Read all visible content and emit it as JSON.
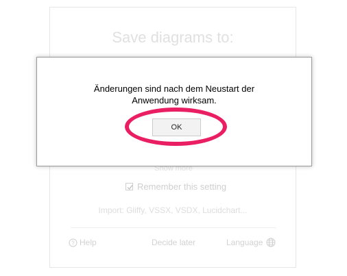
{
  "background": {
    "title": "Save diagrams to:",
    "partial_label": "Show more",
    "remember_label": "Remember this setting",
    "remember_checked": true,
    "import_text": "Import: Gliffy, VSSX, VSDX, Lucidchart...",
    "help_label": "Help",
    "decide_label": "Decide later",
    "language_label": "Language"
  },
  "dialog": {
    "message_line1": "Änderungen sind nach dem Neustart der",
    "message_line2": "Anwendung wirksam.",
    "ok_label": "OK"
  },
  "annotation": {
    "highlight_color": "#ea1f63"
  }
}
